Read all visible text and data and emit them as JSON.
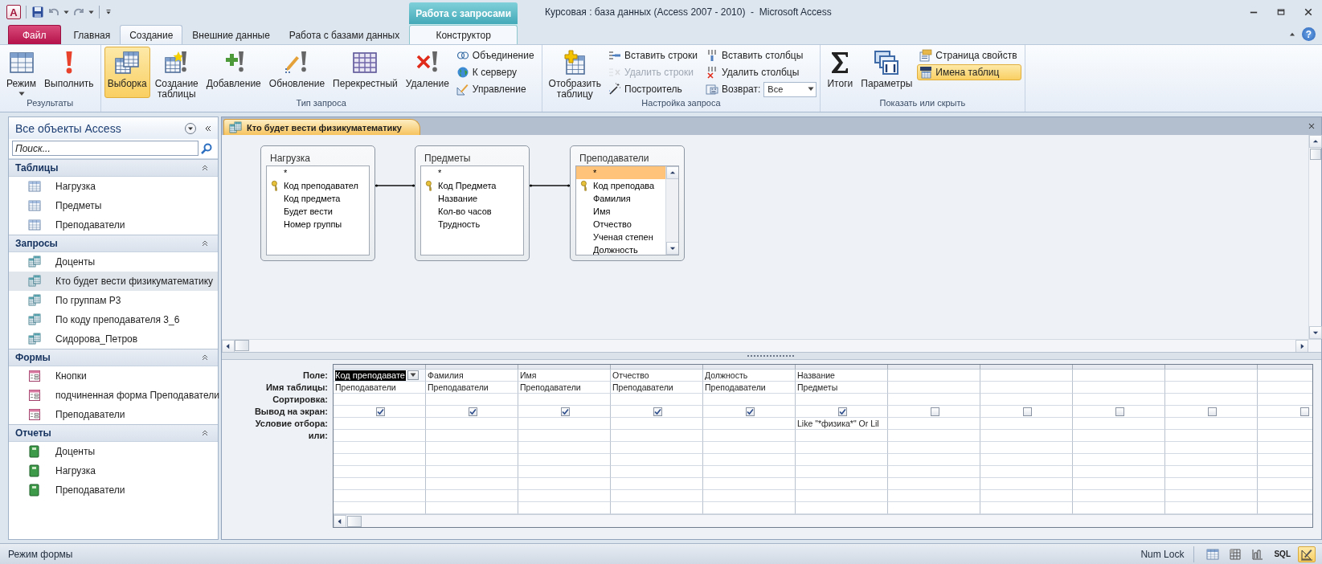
{
  "app_logo": "A",
  "window": {
    "title": "Курсовая : база данных (Access 2007 - 2010)  -  Microsoft Access"
  },
  "ribbon_tabs": [
    {
      "label": "Файл",
      "kind": "file",
      "selected": false,
      "hovered": false
    },
    {
      "label": "Главная",
      "kind": "normal",
      "selected": false,
      "hovered": false
    },
    {
      "label": "Создание",
      "kind": "normal",
      "selected": false,
      "hovered": true
    },
    {
      "label": "Внешние данные",
      "kind": "normal",
      "selected": false,
      "hovered": false
    },
    {
      "label": "Работа с базами данных",
      "kind": "normal",
      "selected": false,
      "hovered": false
    }
  ],
  "context_tabs": {
    "group": "Работа с запросами",
    "tabs": [
      {
        "label": "Конструктор",
        "selected": true
      }
    ]
  },
  "help_button": "?",
  "ribbon_groups": [
    {
      "title": "Результаты",
      "controls": [
        {
          "kind": "large",
          "label": "Режим",
          "dropdown": true,
          "selected": false,
          "disabled": false
        },
        {
          "kind": "large",
          "label": "Выполнить",
          "selected": false,
          "disabled": false
        }
      ]
    },
    {
      "title": "Тип запроса",
      "controls": [
        {
          "kind": "large",
          "label": "Выборка",
          "selected": true,
          "disabled": false
        },
        {
          "kind": "large",
          "label": "Создание таблицы",
          "selected": false,
          "disabled": false
        },
        {
          "kind": "large",
          "label": "Добавление",
          "selected": false,
          "disabled": false
        },
        {
          "kind": "large",
          "label": "Обновление",
          "selected": false,
          "disabled": false
        },
        {
          "kind": "large",
          "label": "Перекрестный",
          "selected": false,
          "disabled": false
        },
        {
          "kind": "large",
          "label": "Удаление",
          "selected": false,
          "disabled": false
        },
        {
          "kind": "small",
          "label": "Объединение",
          "selected": false,
          "disabled": false
        },
        {
          "kind": "small",
          "label": "К серверу",
          "selected": false,
          "disabled": false
        },
        {
          "kind": "small",
          "label": "Управление",
          "selected": false,
          "disabled": false
        }
      ]
    },
    {
      "title": "Настройка запроса",
      "controls": [
        {
          "kind": "large",
          "label": "Отобразить таблицу",
          "selected": false,
          "disabled": false
        },
        {
          "kind": "small",
          "label": "Вставить строки",
          "selected": false,
          "disabled": false
        },
        {
          "kind": "small",
          "label": "Удалить строки",
          "selected": false,
          "disabled": true
        },
        {
          "kind": "small",
          "label": "Построитель",
          "selected": false,
          "disabled": false
        },
        {
          "kind": "small",
          "label": "Вставить столбцы",
          "selected": false,
          "disabled": false
        },
        {
          "kind": "small",
          "label": "Удалить столбцы",
          "selected": false,
          "disabled": false
        },
        {
          "kind": "combo",
          "label": "Возврат:",
          "value": "Все",
          "selected": false,
          "disabled": false
        }
      ]
    },
    {
      "title": "Показать или скрыть",
      "controls": [
        {
          "kind": "large",
          "label": "Итоги",
          "selected": false,
          "disabled": false
        },
        {
          "kind": "large",
          "label": "Параметры",
          "selected": false,
          "disabled": false
        },
        {
          "kind": "small",
          "label": "Страница свойств",
          "selected": false,
          "disabled": false
        },
        {
          "kind": "small",
          "label": "Имена таблиц",
          "selected": true,
          "disabled": false
        }
      ]
    }
  ],
  "navigation": {
    "title": "Все объекты Access",
    "search_placeholder": "Поиск...",
    "sections": [
      {
        "title": "Таблицы",
        "kind": "table",
        "expanded": true,
        "items": [
          {
            "label": "Нагрузка",
            "selected": false
          },
          {
            "label": "Предметы",
            "selected": false
          },
          {
            "label": "Преподаватели",
            "selected": false
          }
        ]
      },
      {
        "title": "Запросы",
        "kind": "query",
        "expanded": true,
        "items": [
          {
            "label": "Доценты",
            "selected": false
          },
          {
            "label": "Кто будет вести физикуматематику",
            "selected": true
          },
          {
            "label": "По группам Р3",
            "selected": false
          },
          {
            "label": "По коду преподавателя 3_6",
            "selected": false
          },
          {
            "label": "Сидорова_Петров",
            "selected": false
          }
        ]
      },
      {
        "title": "Формы",
        "kind": "form",
        "expanded": true,
        "items": [
          {
            "label": "Кнопки",
            "selected": false
          },
          {
            "label": "подчиненная форма Преподаватели",
            "selected": false
          },
          {
            "label": "Преподаватели",
            "selected": false
          }
        ]
      },
      {
        "title": "Отчеты",
        "kind": "report",
        "expanded": true,
        "items": [
          {
            "label": "Доценты",
            "selected": false
          },
          {
            "label": "Нагрузка",
            "selected": false
          },
          {
            "label": "Преподаватели",
            "selected": false
          }
        ]
      }
    ]
  },
  "document": {
    "tab_title": "Кто будет вести физикуматематику",
    "tables": [
      {
        "title": "Нагрузка",
        "scrollable": false,
        "fields": [
          {
            "name": "*",
            "key": false,
            "selected": false
          },
          {
            "name": "Код преподавател",
            "key": true,
            "selected": false
          },
          {
            "name": "Код предмета",
            "key": false,
            "selected": false
          },
          {
            "name": "Будет вести",
            "key": false,
            "selected": false
          },
          {
            "name": "Номер группы",
            "key": false,
            "selected": false
          }
        ]
      },
      {
        "title": "Предметы",
        "scrollable": false,
        "fields": [
          {
            "name": "*",
            "key": false,
            "selected": false
          },
          {
            "name": "Код Предмета",
            "key": true,
            "selected": false
          },
          {
            "name": "Название",
            "key": false,
            "selected": false
          },
          {
            "name": "Кол-во часов",
            "key": false,
            "selected": false
          },
          {
            "name": "Трудность",
            "key": false,
            "selected": false
          }
        ]
      },
      {
        "title": "Преподаватели",
        "scrollable": true,
        "fields": [
          {
            "name": "*",
            "key": false,
            "selected": true
          },
          {
            "name": "Код преподава",
            "key": true,
            "selected": false
          },
          {
            "name": "Фамилия",
            "key": false,
            "selected": false
          },
          {
            "name": "Имя",
            "key": false,
            "selected": false
          },
          {
            "name": "Отчество",
            "key": false,
            "selected": false
          },
          {
            "name": "Ученая степен",
            "key": false,
            "selected": false
          },
          {
            "name": "Должность",
            "key": false,
            "selected": false
          }
        ]
      }
    ]
  },
  "query_grid": {
    "row_labels": [
      "Поле:",
      "Имя таблицы:",
      "Сортировка:",
      "Вывод на экран:",
      "Условие отбора:",
      "или:"
    ],
    "columns": [
      {
        "field": "Код преподавате",
        "table": "Преподаватели",
        "show": true,
        "selected": true
      },
      {
        "field": "Фамилия",
        "table": "Преподаватели",
        "show": true,
        "selected": false
      },
      {
        "field": "Имя",
        "table": "Преподаватели",
        "show": true,
        "selected": false
      },
      {
        "field": "Отчество",
        "table": "Преподаватели",
        "show": true,
        "selected": false
      },
      {
        "field": "Должность",
        "table": "Преподаватели",
        "show": true,
        "selected": false
      },
      {
        "field": "Название",
        "table": "Предметы",
        "criteria": "Like \"*физика*\" Or Lil",
        "show": true,
        "selected": false
      },
      {
        "show": false,
        "selected": false
      },
      {
        "show": false,
        "selected": false
      },
      {
        "show": false,
        "selected": false
      },
      {
        "show": false,
        "selected": false
      },
      {
        "show": false,
        "selected": false
      }
    ]
  },
  "status_bar": {
    "text": "Режим формы",
    "indicator": "Num Lock",
    "views": [
      {
        "kind": "datasheet",
        "selected": false
      },
      {
        "kind": "pivot-table",
        "selected": false
      },
      {
        "kind": "pivot-chart",
        "selected": false
      },
      {
        "kind": "sql",
        "label": "SQL",
        "selected": false
      },
      {
        "kind": "design",
        "selected": true
      }
    ]
  }
}
